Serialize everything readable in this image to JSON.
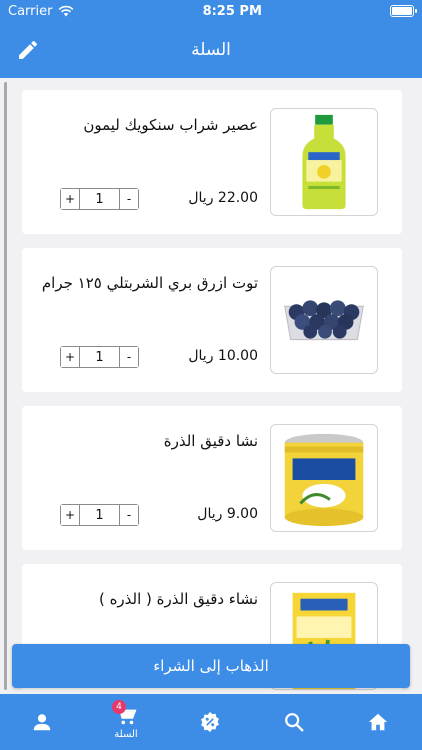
{
  "status_bar": {
    "carrier": "Carrier",
    "time": "8:25 PM"
  },
  "header": {
    "title": "السلة",
    "edit_icon": "pencil-icon"
  },
  "cart": {
    "items": [
      {
        "name": "عصير شراب سنكويك ليمون",
        "price": "22.00 ريال",
        "quantity": "1",
        "image": "juice-bottle"
      },
      {
        "name": "توت ازرق بري الشربتلي ١٢٥ جرام",
        "price": "10.00 ريال",
        "quantity": "1",
        "image": "blueberries"
      },
      {
        "name": "نشا دقيق الذرة",
        "price": "9.00 ريال",
        "quantity": "1",
        "image": "corn-starch-can"
      },
      {
        "name": "نشاء دقيق الذرة ( الذره )",
        "price": "",
        "quantity": "",
        "image": "corn-starch-box"
      }
    ],
    "plus_symbol": "+",
    "minus_symbol": "-"
  },
  "checkout_button": {
    "label": "الذهاب إلى الشراء"
  },
  "tabbar": {
    "tabs": [
      {
        "id": "profile",
        "icon": "person-icon",
        "label": ""
      },
      {
        "id": "cart",
        "icon": "cart-icon",
        "label": "السلة",
        "badge": "4"
      },
      {
        "id": "offers",
        "icon": "discount-badge-icon",
        "label": ""
      },
      {
        "id": "search",
        "icon": "search-icon",
        "label": ""
      },
      {
        "id": "home",
        "icon": "home-icon",
        "label": ""
      }
    ]
  },
  "colors": {
    "primary": "#3d8ce6",
    "badge": "#e8386a",
    "background": "#f1f1f3"
  }
}
